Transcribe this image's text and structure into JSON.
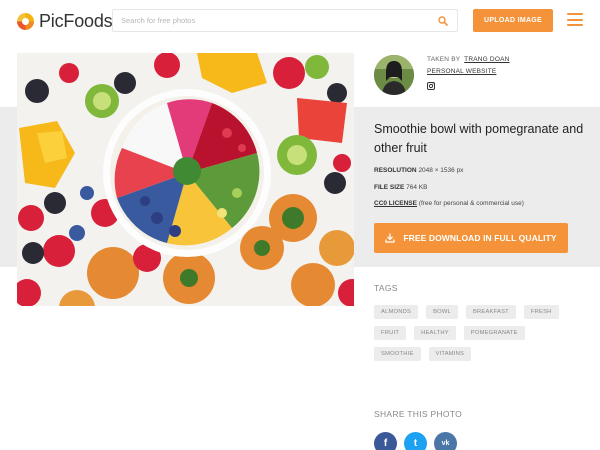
{
  "header": {
    "logo_text": "PicFoods",
    "search_placeholder": "Search for free photos",
    "upload_label": "UPLOAD IMAGE"
  },
  "author": {
    "taken_by_label": "TAKEN BY",
    "name": "TRANG DOAN",
    "website_label": "PERSONAL WEBSITE"
  },
  "photo": {
    "title": "Smoothie bowl with pomegranate and other fruit",
    "resolution_label": "RESOLUTION",
    "resolution_value": "2048 × 1536 px",
    "filesize_label": "FILE SIZE",
    "filesize_value": "764 KB",
    "license_label": "CC0 LICENSE",
    "license_note": "(free for personal & commercial use)"
  },
  "download": {
    "label": "FREE DOWNLOAD IN FULL QUALITY"
  },
  "tags": {
    "label": "TAGS",
    "items": [
      "ALMONDS",
      "BOWL",
      "BREAKFAST",
      "FRESH",
      "FRUIT",
      "HEALTHY",
      "POMEGRANATE",
      "SMOOTHIE",
      "VITAMINS"
    ]
  },
  "share": {
    "label": "SHARE THIS PHOTO",
    "facebook": "f",
    "twitter": "t",
    "vk": "vk"
  },
  "colors": {
    "accent": "#f4933a",
    "band": "#ececec",
    "facebook": "#3b5998",
    "twitter": "#1da1f2",
    "vk": "#4a76a8"
  }
}
